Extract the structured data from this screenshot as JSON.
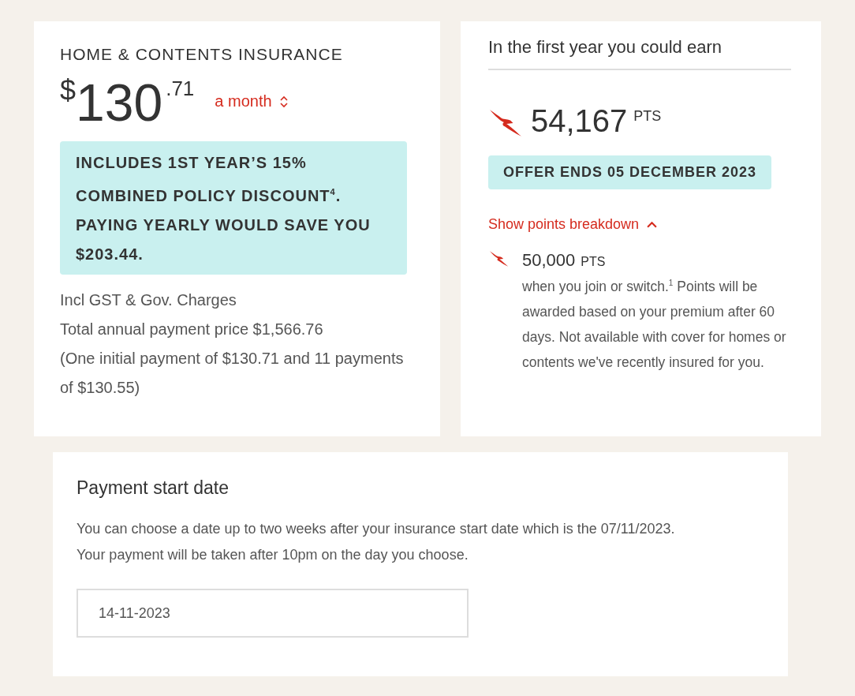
{
  "insurance": {
    "title": "HOME & CONTENTS INSURANCE",
    "price": {
      "currency": "$",
      "dollars": "130",
      "cents": ".71"
    },
    "frequency": "a month",
    "discount_banner": "INCLUDES 1ST YEAR’S 15% COMBINED POLICY DISCOUNT$^{4}$. PAYING YEARLY WOULD SAVE YOU $203.44.",
    "notes": [
      "Incl GST & Gov. Charges",
      "Total annual payment price $1,566.76",
      "(One initial payment of $130.71 and 11 payments of $130.55)"
    ]
  },
  "points": {
    "heading": "In the first year you could earn",
    "total": "54,167",
    "unit": "PTS",
    "offer": "OFFER ENDS 05 DECEMBER 2023",
    "breakdown_toggle": {
      "label": "Show points breakdown",
      "expanded": true
    },
    "breakdown": [
      {
        "points": "50,000",
        "unit": "PTS",
        "description": "when you join or switch.$^{1}$ Points will be awarded based on your premium after 60 days. Not available with cover for homes or contents we've recently insured for you."
      }
    ]
  },
  "payment": {
    "title": "Payment start date",
    "description": "You can choose a date up to two weeks after your insurance start date which is the 07/11/2023. Your payment will be taken after 10pm on the day you choose.",
    "date_field": {
      "value": "14-11-2023"
    }
  }
}
